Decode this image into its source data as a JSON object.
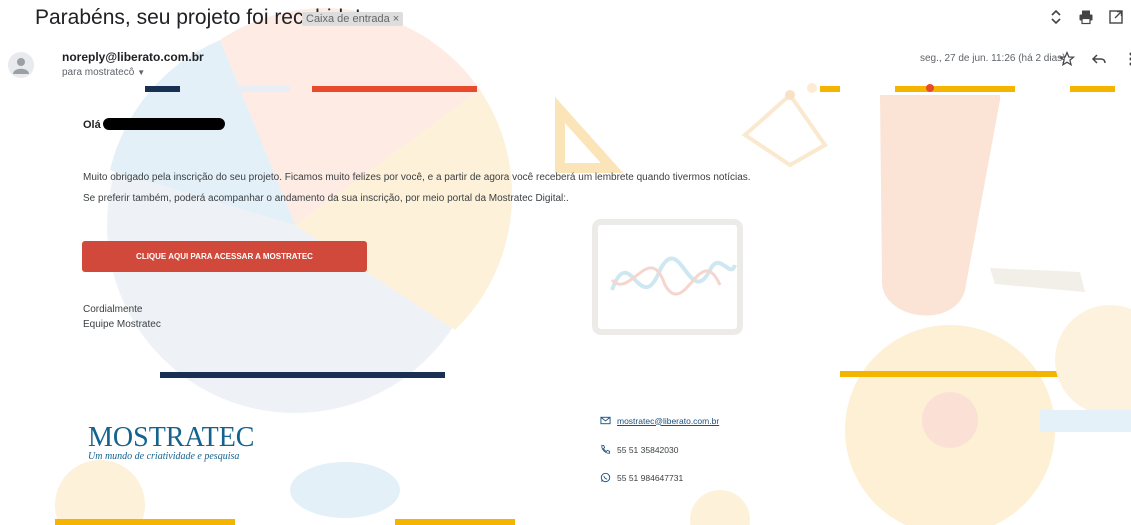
{
  "email": {
    "subject": "Parabéns, seu projeto foi recebido!",
    "label": "Caixa de entrada",
    "label_remove": "×",
    "sender": "noreply@liberato.com.br",
    "recipient": "para mostratecô",
    "date": "seg., 27 de jun. 11:26 (há 2 dias)"
  },
  "body": {
    "greeting": "Olá",
    "paragraph1": "Muito obrigado pela inscrição do seu projeto. Ficamos muito felizes por você, e a partir de agora você receberá um lembrete quando tivermos notícias.",
    "paragraph2": "Se preferir também, poderá acompanhar o andamento da sua inscrição, por meio portal da Mostratec Digital:.",
    "cta_label": "CLIQUE AQUI PARA ACESSAR A MOSTRATEC",
    "sign_line1": "Cordialmente",
    "sign_line2": "Equipe Mostratec"
  },
  "footer": {
    "logo_text": "MOSTRATEC",
    "logo_tagline": "Um mundo de criatividade e pesquisa",
    "email": "mostratec@liberato.com.br",
    "phone": "55 51 35842030",
    "whatsapp": "55 51 984647731"
  },
  "icons": {
    "top": [
      "up-down-icon",
      "print-icon",
      "open-new-window-icon"
    ],
    "message": [
      "star-icon",
      "reply-icon",
      "more-vert-icon"
    ],
    "contact": [
      "envelope-icon",
      "phone-icon",
      "whatsapp-icon"
    ]
  },
  "colors": {
    "cta": "#d0493b",
    "logo": "#14638f",
    "link": "#1a4f7c"
  }
}
